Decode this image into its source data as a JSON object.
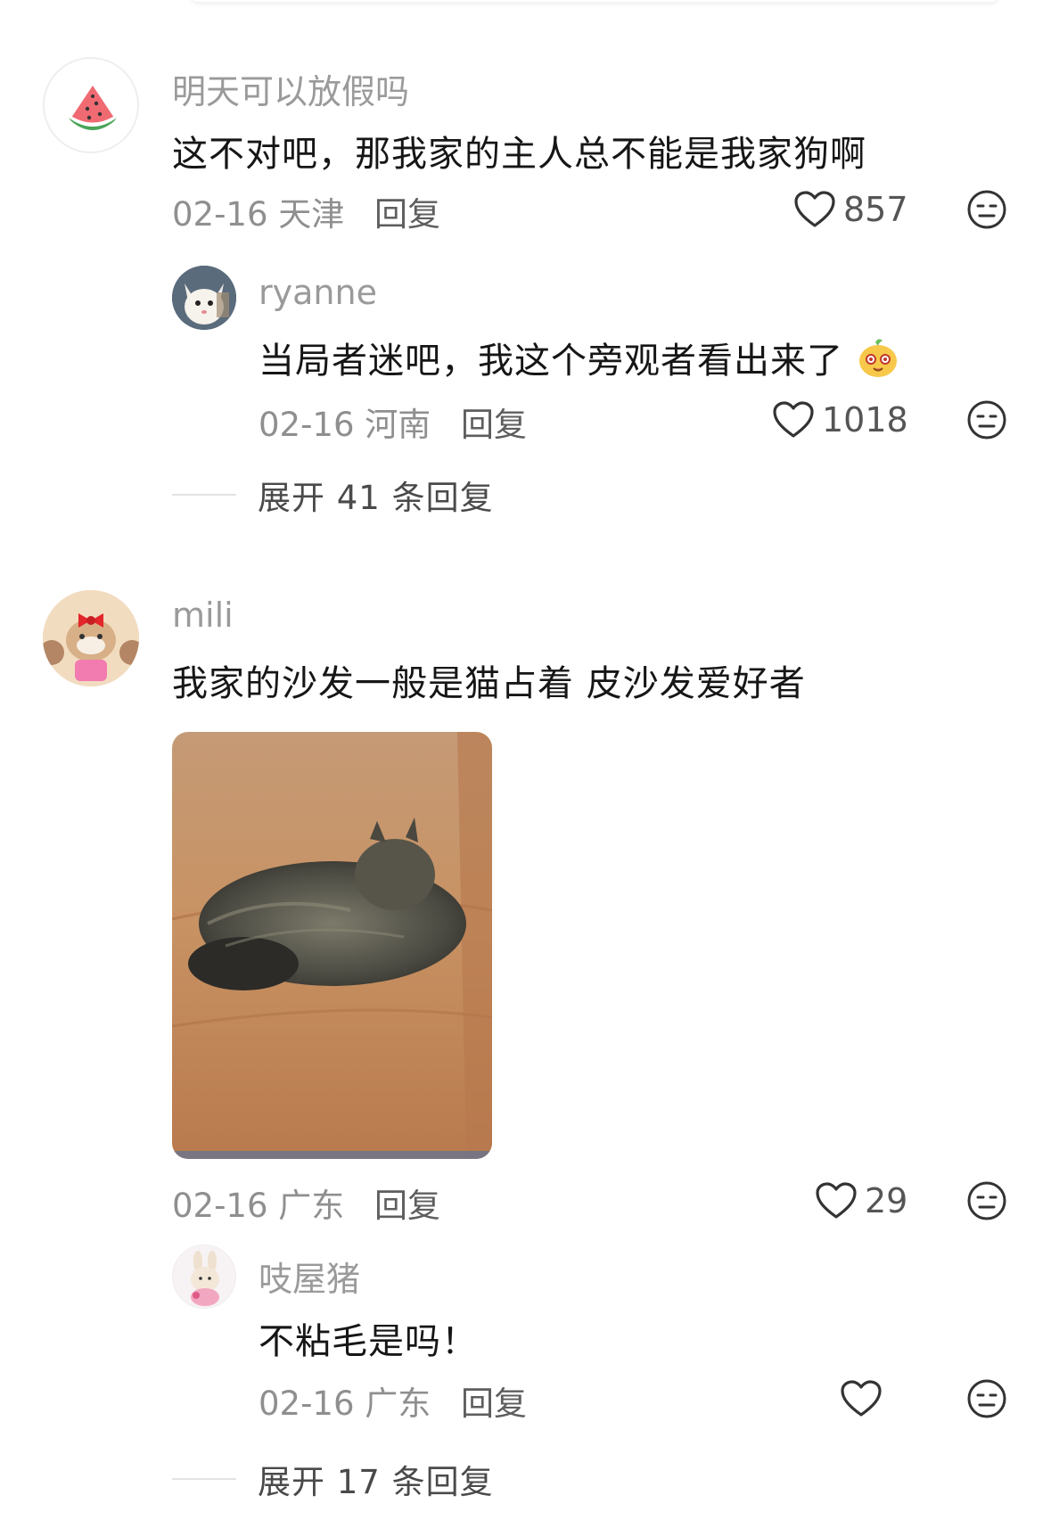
{
  "comments": [
    {
      "username": "明天可以放假吗",
      "text": "这不对吧，那我家的主人总不能是我家狗啊",
      "date_location": "02-16 天津",
      "reply_label": "回复",
      "likes": "857",
      "avatar_icon": "watermelon-icon",
      "replies": [
        {
          "username": "ryanne",
          "text": "当局者迷吧，我这个旁观者看出来了",
          "date_location": "02-16 河南",
          "reply_label": "回复",
          "likes": "1018",
          "avatar_icon": "cat-avatar",
          "emoji": "smiling-face-emoji"
        }
      ],
      "expand_label": "展开 41 条回复"
    },
    {
      "username": "mili",
      "text": "我家的沙发一般是猫占着 皮沙发爱好者",
      "date_location": "02-16 广东",
      "reply_label": "回复",
      "likes": "29",
      "avatar_icon": "bow-bear-avatar",
      "image": "cat-on-leather-sofa-photo",
      "replies": [
        {
          "username": "吱屋猪",
          "text": "不粘毛是吗！",
          "date_location": "02-16 广东",
          "reply_label": "回复",
          "likes": "",
          "avatar_icon": "bunny-avatar"
        }
      ],
      "expand_label": "展开 17 条回复"
    }
  ],
  "colors": {
    "username": "#9a9a9a",
    "text": "#161616",
    "meta": "#8f8f8f",
    "divider": "#e3e3e3"
  }
}
